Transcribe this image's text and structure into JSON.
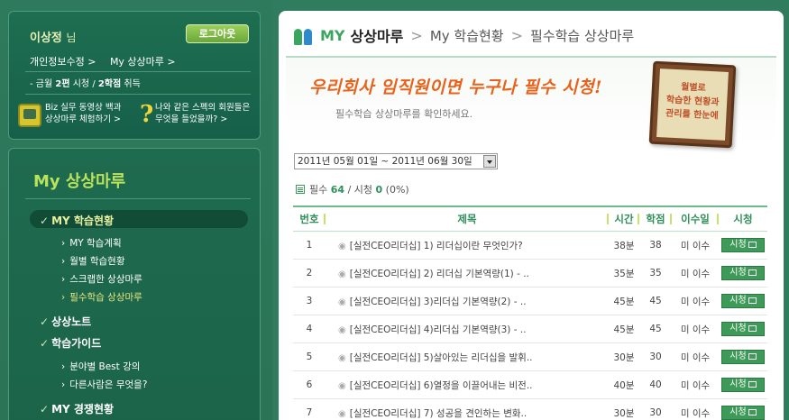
{
  "user": {
    "name": "이상정",
    "suffix": "님",
    "logout_label": "로그아웃",
    "links": [
      "개인정보수정 >",
      "My 상상마루 >"
    ],
    "usage_prefix": "- 금월",
    "usage_watch_count": "2편",
    "usage_watch_label": "시청 /",
    "usage_drop_count": "2학점",
    "usage_drop_label": "취득"
  },
  "promos": [
    {
      "line1": "Biz 실무 동영상 백과",
      "line2": "상상마루 체험하기 >",
      "icon": "tv-icon"
    },
    {
      "line1": "나와 같은 스펙의 회원들은",
      "line2": "무엇을 들었을까? >",
      "icon": "question-icon"
    }
  ],
  "menu": {
    "title": "My 상상마루",
    "items": [
      {
        "label": "MY 학습현황",
        "active": true,
        "subs": [
          {
            "label": "MY 학습계획",
            "active": false
          },
          {
            "label": "월별 학습현황",
            "active": false
          },
          {
            "label": "스크랩한 상상마루",
            "active": false
          },
          {
            "label": "필수학습 상상마루",
            "active": true
          }
        ]
      },
      {
        "label": "상상노트",
        "active": false,
        "subs": []
      },
      {
        "label": "학습가이드",
        "active": false,
        "subs": [
          {
            "label": "분야별 Best 강의",
            "active": false
          },
          {
            "label": "다른사람은 무엇을?",
            "active": false
          }
        ]
      },
      {
        "label": "MY 경쟁현황",
        "active": false,
        "subs": []
      }
    ]
  },
  "breadcrumb": {
    "my": "MY",
    "main": "상상마루",
    "sep": ">",
    "level2": "My 학습현황",
    "level3": "필수학습 상상마루"
  },
  "banner": {
    "title": "우리회사 임직원이면 누구나 필수 시청!",
    "subtitle": "필수학습 상상마루를 확인하세요.",
    "frame_text": "월별로\n학습한 현황과\n관리를 한눈에"
  },
  "date_range": "2011년 05월 01일 ~ 2011년 06월 30일",
  "counts": {
    "required_label": "필수",
    "required_value": "64",
    "watched_label": "/ 시청",
    "watched_value": "0",
    "percent": "(0%)"
  },
  "table": {
    "headers": [
      "번호",
      "제목",
      "시간",
      "학점",
      "이수일",
      "시청"
    ],
    "rows": [
      {
        "no": "1",
        "title": "[실전CEO리더십] 1) 리더십이란 무엇인가?",
        "time": "38분",
        "credit": "38",
        "done": "미 이수",
        "watch": "시청"
      },
      {
        "no": "2",
        "title": "[실전CEO리더십] 2) 리더십 기본역량(1) - ..",
        "time": "35분",
        "credit": "35",
        "done": "미 이수",
        "watch": "시청"
      },
      {
        "no": "3",
        "title": "[실전CEO리더십] 3)리더십 기본역량(2) - ..",
        "time": "45분",
        "credit": "45",
        "done": "미 이수",
        "watch": "시청"
      },
      {
        "no": "4",
        "title": "[실전CEO리더십] 4)리더십 기본역량(3) - ..",
        "time": "45분",
        "credit": "45",
        "done": "미 이수",
        "watch": "시청"
      },
      {
        "no": "5",
        "title": "[실전CEO리더십] 5)살아있는 리더십을 발휘..",
        "time": "30분",
        "credit": "30",
        "done": "미 이수",
        "watch": "시청"
      },
      {
        "no": "6",
        "title": "[실전CEO리더십] 6)열정을 이끌어내는 비전..",
        "time": "40분",
        "credit": "40",
        "done": "미 이수",
        "watch": "시청"
      },
      {
        "no": "7",
        "title": "[실전CEO리더십] 7) 성공을 견인하는 변화..",
        "time": "30분",
        "credit": "30",
        "done": "미 이수",
        "watch": "시청"
      }
    ]
  },
  "colors": {
    "page_bg": "#2f7d5e",
    "accent_green": "#3aa55e",
    "banner_orange": "#e8621c",
    "menu_highlight": "#b9e35a"
  }
}
